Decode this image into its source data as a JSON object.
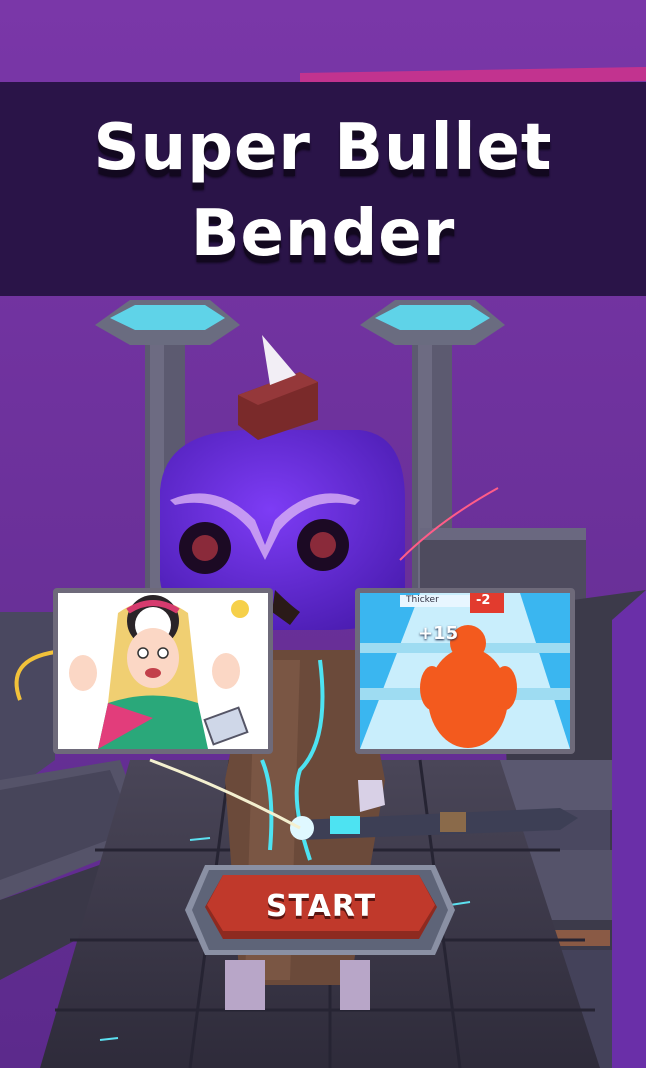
{
  "game": {
    "title_line1": "Super Bullet",
    "title_line2": "Bender",
    "start_label": "START"
  },
  "ads": [
    {
      "name": "puzzle-game-ad"
    },
    {
      "name": "runner-game-ad",
      "label": "Thicker",
      "badge_plus": "+15",
      "badge_minus": "-2"
    }
  ],
  "colors": {
    "background": "#6d2f9a",
    "banner": "#2a1448",
    "start_button": "#c0392b",
    "character_head": "#6a2ce0"
  }
}
